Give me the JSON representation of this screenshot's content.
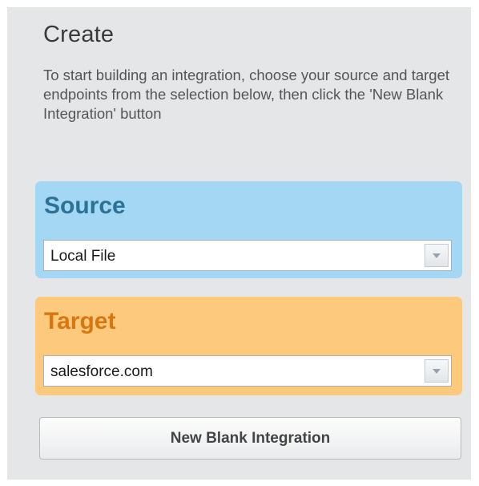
{
  "create": {
    "title": "Create",
    "description": "To start building an integration, choose your source and target endpoints from the selection below, then click the 'New Blank Integration' button"
  },
  "source": {
    "heading": "Source",
    "selected": "Local File"
  },
  "target": {
    "heading": "Target",
    "selected": "salesforce.com"
  },
  "actions": {
    "new_blank_label": "New Blank Integration"
  },
  "colors": {
    "panel_bg": "#e5e6e8",
    "source_bg": "#a3d7f4",
    "source_heading": "#2c7296",
    "target_bg": "#fcc97d",
    "target_heading": "#d8770f"
  }
}
